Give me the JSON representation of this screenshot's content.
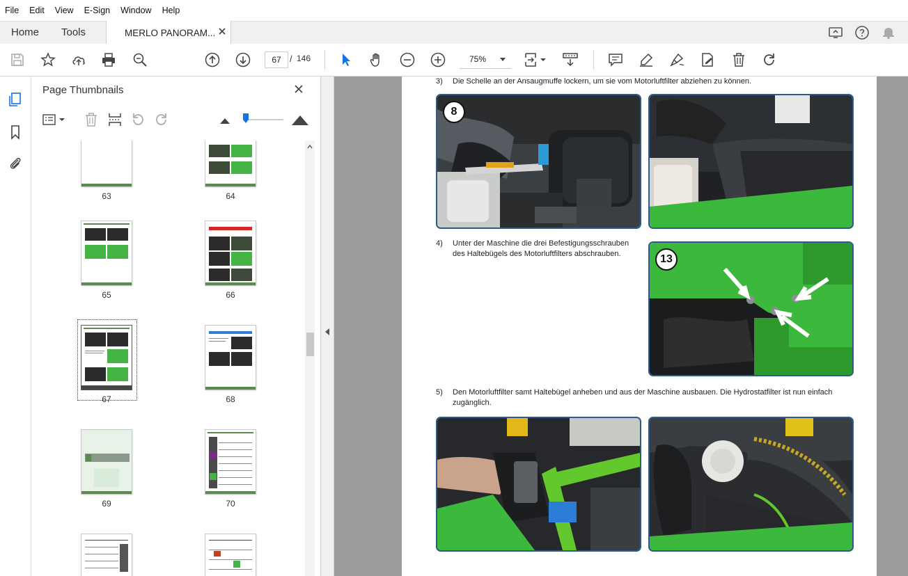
{
  "menu": [
    "File",
    "Edit",
    "View",
    "E-Sign",
    "Window",
    "Help"
  ],
  "tabs": {
    "home": "Home",
    "tools": "Tools",
    "document": "MERLO PANORAM..."
  },
  "toolbar": {
    "current_page": "67",
    "page_separator": "/",
    "total_pages": "146",
    "zoom": "75%"
  },
  "panel": {
    "title": "Page Thumbnails",
    "thumbnails": [
      {
        "label": "63"
      },
      {
        "label": "64"
      },
      {
        "label": "65"
      },
      {
        "label": "66"
      },
      {
        "label": "67",
        "selected": true
      },
      {
        "label": "68"
      },
      {
        "label": "69"
      },
      {
        "label": "70"
      },
      {
        "label": ""
      },
      {
        "label": ""
      }
    ]
  },
  "document": {
    "steps": [
      {
        "num": "3)",
        "text": "Die Schelle an der Ansaugmuffe lockern, um sie vom Motorluftfilter abziehen zu können."
      },
      {
        "num": "4)",
        "text": "Unter der Maschine die drei Befestigungsschrauben",
        "text2": "des Haltebügels des Motorluftfilters abschrauben."
      },
      {
        "num": "5)",
        "text": "Den Motorluftfilter samt Haltebügel anheben und aus der Maschine ausbauen. Die Hydrostatfilter ist nun einfach",
        "text2": "zugänglich."
      }
    ],
    "badges": [
      "8",
      "13"
    ]
  },
  "colors": {
    "accent": "#1473e6",
    "machine_green": "#3cb93c",
    "photo_border": "#2d5a8c",
    "page_bg": "#9b9b9b"
  }
}
